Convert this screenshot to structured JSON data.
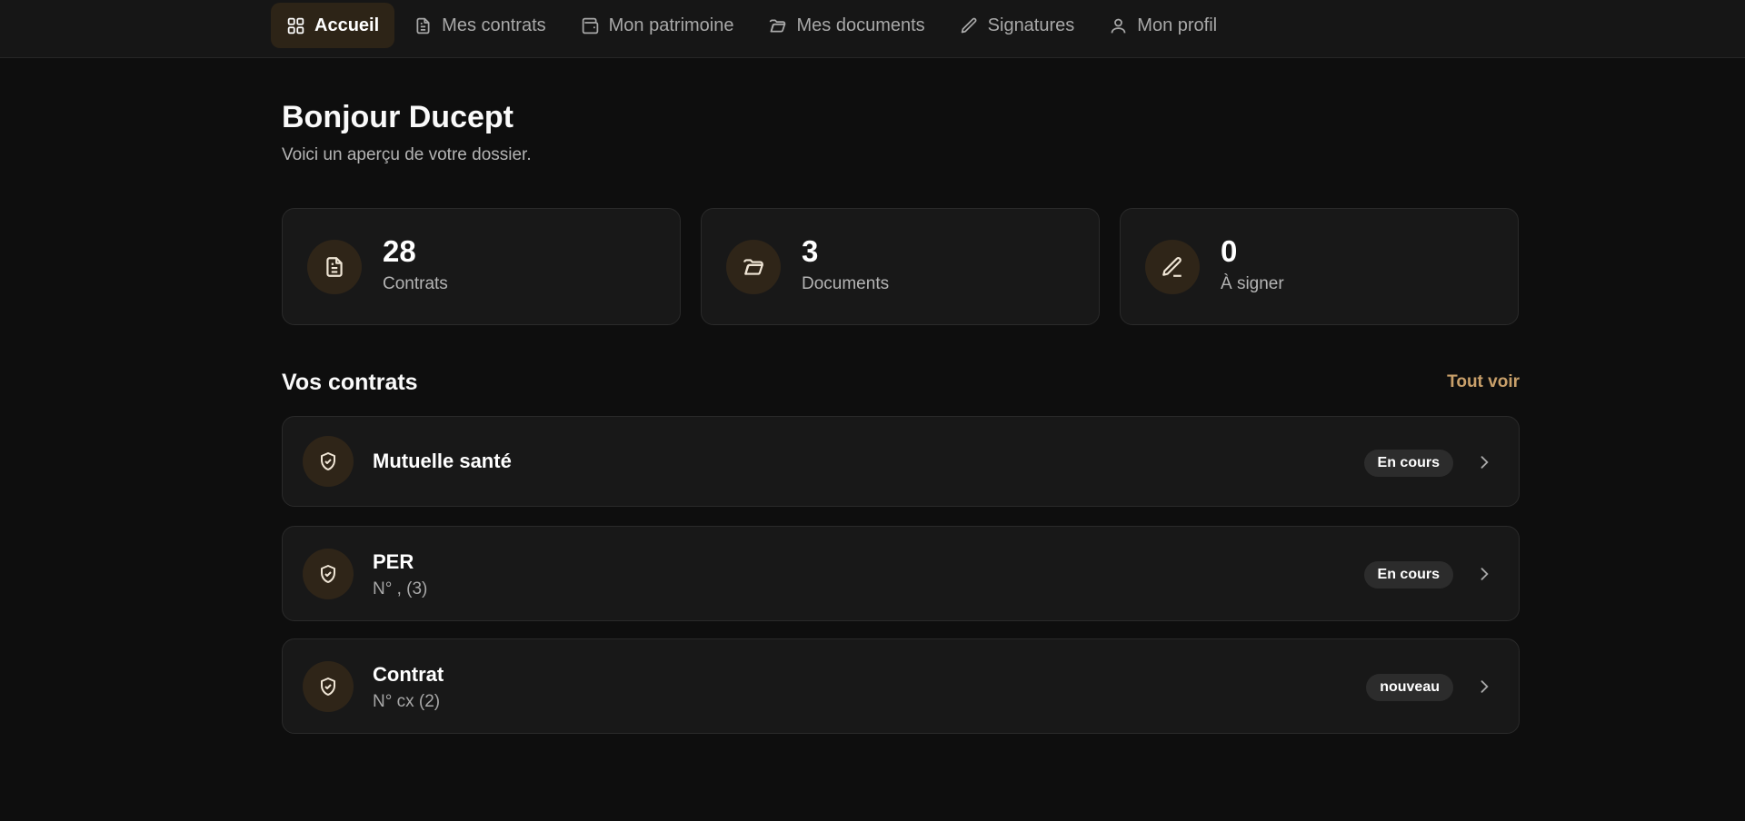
{
  "nav": {
    "items": [
      {
        "label": "Accueil",
        "icon": "dashboard-icon",
        "active": true
      },
      {
        "label": "Mes contrats",
        "icon": "file-icon"
      },
      {
        "label": "Mon patrimoine",
        "icon": "wallet-icon"
      },
      {
        "label": "Mes documents",
        "icon": "folder-icon"
      },
      {
        "label": "Signatures",
        "icon": "pen-icon"
      },
      {
        "label": "Mon profil",
        "icon": "user-icon"
      }
    ]
  },
  "header": {
    "greeting": "Bonjour Ducept",
    "subtitle": "Voici un aperçu de votre dossier."
  },
  "stats": [
    {
      "value": "28",
      "label": "Contrats",
      "icon": "file-icon"
    },
    {
      "value": "3",
      "label": "Documents",
      "icon": "folder-icon"
    },
    {
      "value": "0",
      "label": "À signer",
      "icon": "pen-icon"
    }
  ],
  "contracts_section": {
    "title": "Vos contrats",
    "see_all": "Tout voir",
    "items": [
      {
        "name": "Mutuelle santé",
        "number": "",
        "status": "En cours",
        "icon": "shield-check-icon"
      },
      {
        "name": "PER",
        "number": "N° , (3)",
        "status": "En cours",
        "icon": "shield-check-icon"
      },
      {
        "name": "Contrat",
        "number": "N° cx (2)",
        "status": "nouveau",
        "icon": "shield-check-icon"
      }
    ]
  },
  "colors": {
    "background": "#0e0e0e",
    "card": "#181818",
    "accent": "#c9a06a",
    "icon_circle": "#2f2518"
  }
}
